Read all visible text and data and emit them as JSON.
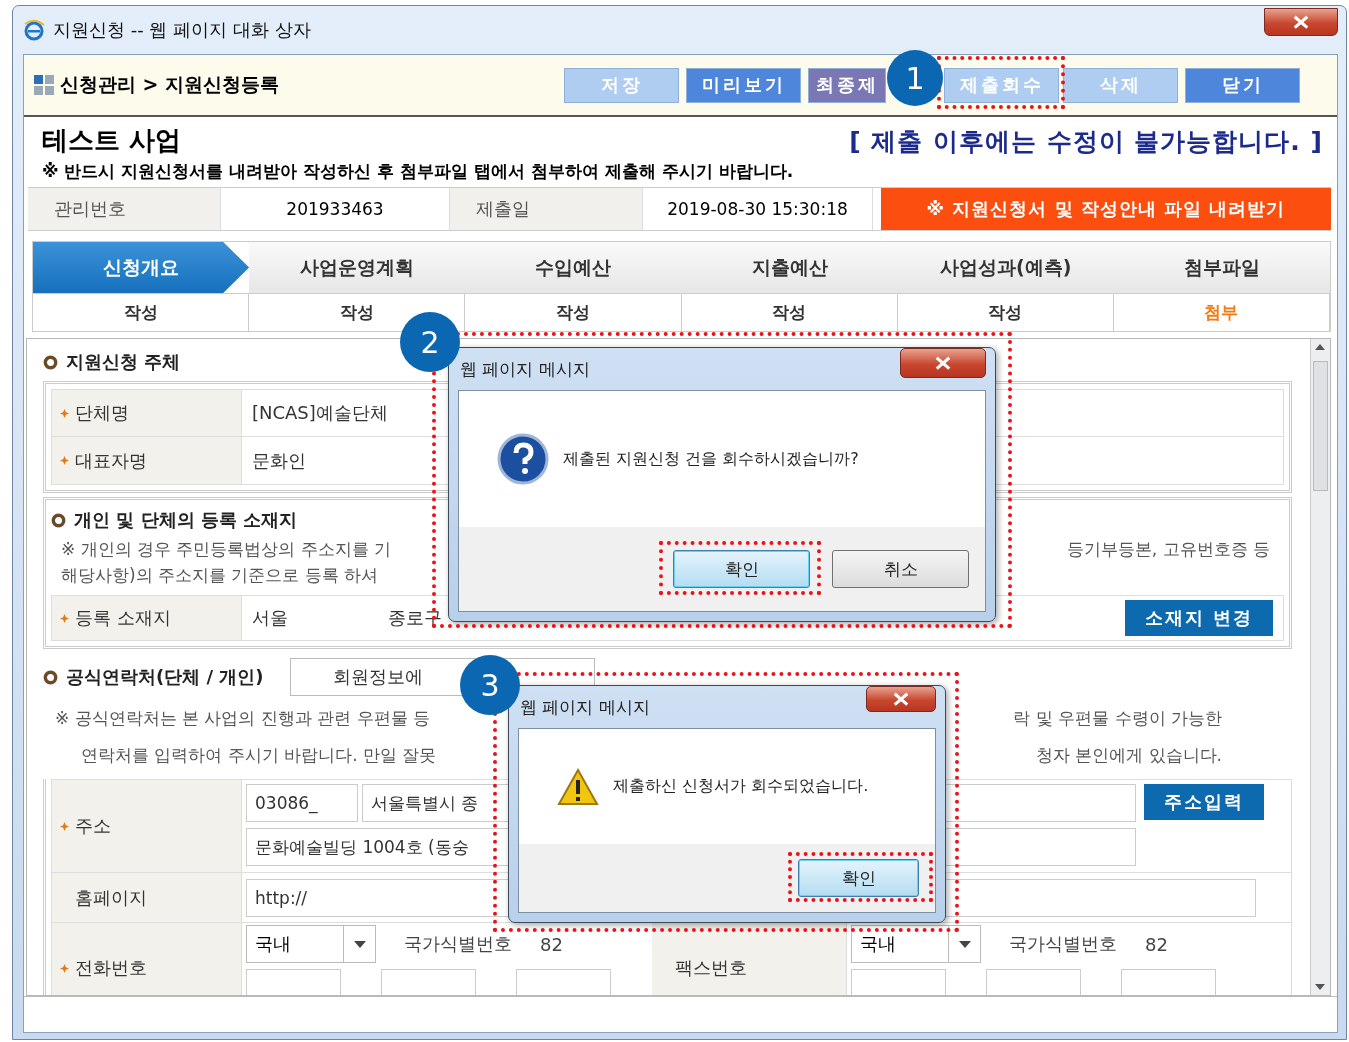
{
  "window": {
    "title": "지원신청 -- 웹 페이지 대화 상자"
  },
  "toolbar": {
    "breadcrumb": "신청관리 > 지원신청등록",
    "buttons": [
      {
        "label": "저장",
        "kind": "normal",
        "disabled": true
      },
      {
        "label": "미리보기",
        "kind": "normal",
        "disabled": false
      },
      {
        "label": "최종제",
        "kind": "final",
        "disabled": false
      },
      {
        "label": "제출회수",
        "kind": "normal",
        "disabled": true
      },
      {
        "label": "삭제",
        "kind": "normal",
        "disabled": true
      },
      {
        "label": "닫기",
        "kind": "normal",
        "disabled": false
      }
    ]
  },
  "header": {
    "title": "테스트 사업",
    "warning": "[ 제출 이후에는 수정이 불가능합니다. ]",
    "notice": "※ 반드시 지원신청서를 내려받아 작성하신 후 첨부파일 탭에서 첨부하여 제출해 주시기 바랍니다."
  },
  "info": [
    {
      "label": "관리번호",
      "value": "201933463"
    },
    {
      "label": "제출일",
      "value": "2019-08-30  15:30:18"
    }
  ],
  "download_button": "※ 지원신청서 및 작성안내 파일 내려받기",
  "steps": [
    {
      "label": "신청개요",
      "action": "작성",
      "selected": true,
      "kind": "write"
    },
    {
      "label": "사업운영계획",
      "action": "작성",
      "selected": false,
      "kind": "write"
    },
    {
      "label": "수입예산",
      "action": "작성",
      "selected": false,
      "kind": "write"
    },
    {
      "label": "지출예산",
      "action": "작성",
      "selected": false,
      "kind": "write"
    },
    {
      "label": "사업성과(예측)",
      "action": "작성",
      "selected": false,
      "kind": "write"
    },
    {
      "label": "첨부파일",
      "action": "첨부",
      "selected": false,
      "kind": "attach"
    }
  ],
  "applicant": {
    "title": "지원신청 주체",
    "rows": [
      {
        "label": "단체명",
        "value": "[NCAS]예술단체",
        "required": true
      },
      {
        "label": "대표자명",
        "value": "문화인",
        "required": true
      }
    ]
  },
  "location": {
    "title": "개인 및 단체의 등록 소재지",
    "notes": [
      {
        "left": "※ 개인의 경우 주민등록법상의 주소지를 기",
        "right": "등기부등본, 고유번호증 등"
      },
      {
        "left": "해당사항)의 주소지를 기준으로 등록 하셔"
      }
    ],
    "label": "등록 소재지",
    "required": true,
    "city": "서울",
    "district": "종로구",
    "button": "소재지 변경"
  },
  "contact": {
    "title": "공식연락처(단체 / 개인)",
    "member_button": "회원정보에",
    "notes": [
      {
        "left": "※ 공식연락처는 본 사업의 진행과 관련 우편물 등",
        "right": "락 및 우편물 수령이 가능한"
      },
      {
        "left": "연락처를 입력하여 주시기 바랍니다. 만일 잘못",
        "right": "청자 본인에게 있습니다."
      }
    ],
    "address": {
      "label": "주소",
      "required": true,
      "zip": "03086_",
      "addr1": "서울특별시 종",
      "addr2": "문화예술빌딩 1004호 (동숭",
      "button": "주소입력"
    },
    "homepage": {
      "label": "홈페이지",
      "required": false,
      "value": "http://"
    },
    "phone": {
      "label": "전화번호",
      "required": true,
      "region": "국내",
      "code_label": "국가식별번호",
      "code": "82"
    },
    "fax": {
      "label": "팩스번호",
      "required": false,
      "region": "국내",
      "code_label": "국가식별번호",
      "code": "82"
    }
  },
  "dialogs": [
    {
      "title": "웹 페이지 메시지",
      "kind": "question",
      "message": "제출된 지원신청 건을 회수하시겠습니까?",
      "buttons": [
        {
          "label": "확인",
          "default": true
        },
        {
          "label": "취소",
          "default": false
        }
      ]
    },
    {
      "title": "웹 페이지 메시지",
      "kind": "warning",
      "message": "제출하신 신청서가 회수되었습니다.",
      "buttons": [
        {
          "label": "확인",
          "default": true
        }
      ]
    }
  ],
  "callouts": [
    "1",
    "2",
    "3"
  ]
}
